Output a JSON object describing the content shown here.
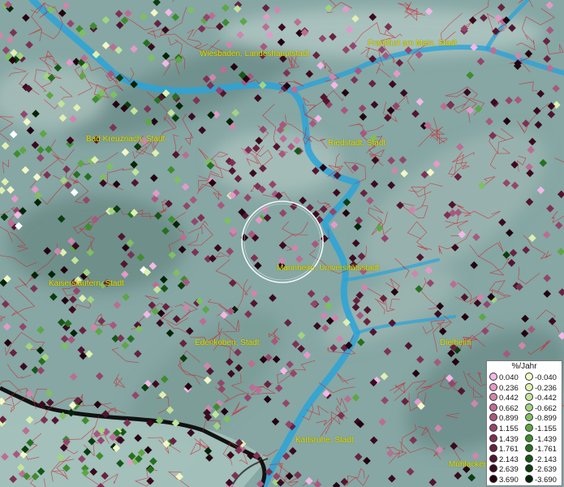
{
  "map": {
    "cities": [
      {
        "name": "Wiesbaden, Landeshauptstadt"
      },
      {
        "name": "Frankfurt am Main, Stadt"
      },
      {
        "name": "Bad Kreuznach, Stadt"
      },
      {
        "name": "Riedstadt, Stadt"
      },
      {
        "name": "Mannheim, Universitätsstadt"
      },
      {
        "name": "Kaiserslautern, Stadt"
      },
      {
        "name": "Edenkoben, Stadt"
      },
      {
        "name": "Dielheim"
      },
      {
        "name": "Karlsruhe, Stadt"
      },
      {
        "name": "Mühlacker"
      }
    ],
    "legend": {
      "title": "%/Jahr",
      "positive": [
        {
          "label": "0.040",
          "color": "#f2b8e6"
        },
        {
          "label": "0.236",
          "color": "#e39ac8"
        },
        {
          "label": "0.442",
          "color": "#cf86ad"
        },
        {
          "label": "0.662",
          "color": "#bc6d94"
        },
        {
          "label": "0.899",
          "color": "#a7587f"
        },
        {
          "label": "1.155",
          "color": "#93466b"
        },
        {
          "label": "1.439",
          "color": "#7d3254"
        },
        {
          "label": "1.761",
          "color": "#682240"
        },
        {
          "label": "2.143",
          "color": "#52152f"
        },
        {
          "label": "2.639",
          "color": "#3b0a1f"
        },
        {
          "label": "3.690",
          "color": "#240311"
        }
      ],
      "negative": [
        {
          "label": "-0.040",
          "color": "#f3f7c7"
        },
        {
          "label": "-0.236",
          "color": "#dff0b0"
        },
        {
          "label": "-0.442",
          "color": "#c3e49a"
        },
        {
          "label": "-0.662",
          "color": "#a2d47f"
        },
        {
          "label": "-0.899",
          "color": "#7fbf61"
        },
        {
          "label": "-1.155",
          "color": "#5ea645"
        },
        {
          "label": "-1.439",
          "color": "#3f8c30"
        },
        {
          "label": "-1.761",
          "color": "#277020"
        },
        {
          "label": "-2.143",
          "color": "#175616"
        },
        {
          "label": "-2.639",
          "color": "#0c3d0e"
        },
        {
          "label": "-3.690",
          "color": "#042407"
        }
      ]
    }
  }
}
